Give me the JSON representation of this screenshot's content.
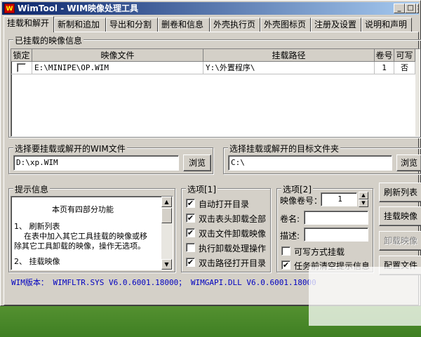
{
  "window": {
    "title": "WimTool - WIM映像处理工具",
    "minimize": "_",
    "maximize": "□",
    "close": "×"
  },
  "tabs": [
    "挂载和解开",
    "新制和追加",
    "导出和分割",
    "删卷和信息",
    "外壳执行页",
    "外壳图标页",
    "注册及设置",
    "说明和声明"
  ],
  "mounted": {
    "group_label": "已挂载的映像信息",
    "columns": [
      "锁定",
      "映像文件",
      "挂载路径",
      "卷号",
      "可写"
    ],
    "rows": [
      {
        "locked": false,
        "image": "E:\\MINIPE\\OP.WIM",
        "path": "Y:\\外置程序\\",
        "volume": "1",
        "writable": "否"
      }
    ]
  },
  "wim_select": {
    "label": "选择要挂载或解开的WIM文件",
    "value": "D:\\xp.WIM",
    "browse": "浏览"
  },
  "target_select": {
    "label": "选择挂载或解开的目标文件夹",
    "value": "C:\\",
    "browse": "浏览"
  },
  "hint": {
    "label": "提示信息",
    "lines": [
      "本页有四部分功能",
      "1、 刷新列表",
      "在表中加入其它工具挂载的映像或移",
      "除其它工具卸载的映像，操作无选项。",
      "2、 挂载映像"
    ]
  },
  "options1": {
    "label": "选项[1]",
    "items": [
      {
        "text": "自动打开目录",
        "checked": true
      },
      {
        "text": "双击表头卸载全部",
        "checked": true
      },
      {
        "text": "双击文件卸载映像",
        "checked": true
      },
      {
        "text": "执行卸载处理操作",
        "checked": false
      },
      {
        "text": "双击路径打开目录",
        "checked": true
      }
    ]
  },
  "options2": {
    "label": "选项[2]",
    "volume_label": "映像卷号：",
    "volume_value": "1",
    "name_label": "卷名:",
    "desc_label": "描述:",
    "writable_mount": {
      "text": "可写方式挂载",
      "checked": false
    },
    "clear_hint": {
      "text": "任务前清空提示信息",
      "checked": true
    }
  },
  "actions": {
    "refresh": "刷新列表",
    "mount": "挂载映像",
    "unmount": "卸载映像",
    "config": "配置文件"
  },
  "status": "WIM版本： WIMFLTR.SYS V6.0.6001.18000； WIMGAPI.DLL V6.0.6001.18000",
  "icons": {
    "check": "✔",
    "up": "▲",
    "down": "▼"
  }
}
